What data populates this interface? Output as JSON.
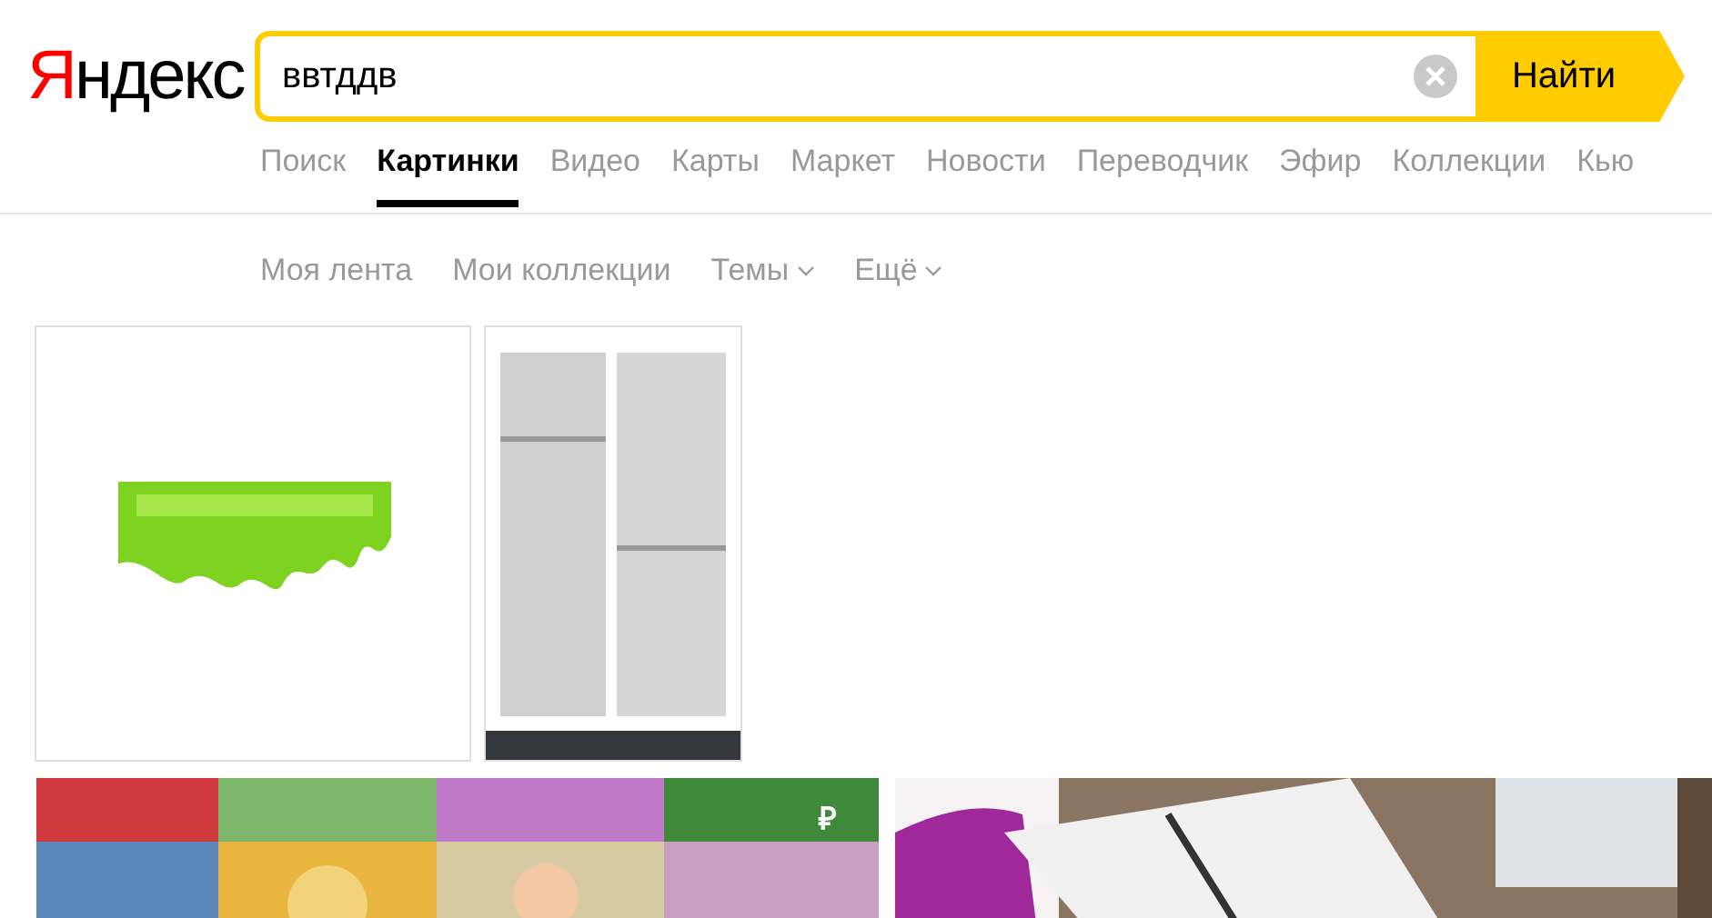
{
  "logo": "Яндекс",
  "search": {
    "value": "ввтддв",
    "button": "Найти"
  },
  "tabs": [
    {
      "label": "Поиск",
      "selected": false
    },
    {
      "label": "Картинки",
      "selected": true
    },
    {
      "label": "Видео",
      "selected": false
    },
    {
      "label": "Карты",
      "selected": false
    },
    {
      "label": "Маркет",
      "selected": false
    },
    {
      "label": "Новости",
      "selected": false
    },
    {
      "label": "Переводчик",
      "selected": false
    },
    {
      "label": "Эфир",
      "selected": false
    },
    {
      "label": "Коллекции",
      "selected": false
    },
    {
      "label": "Кью",
      "selected": false
    }
  ],
  "subnav": [
    {
      "label": "Моя лента",
      "dropdown": false
    },
    {
      "label": "Мои коллекции",
      "dropdown": false
    },
    {
      "label": "Темы",
      "dropdown": true
    },
    {
      "label": "Ещё",
      "dropdown": true
    }
  ],
  "results": [
    {
      "kind": "picture"
    },
    {
      "kind": "picture"
    },
    {
      "kind": "picture",
      "badge": "₽"
    },
    {
      "kind": "picture"
    }
  ]
}
